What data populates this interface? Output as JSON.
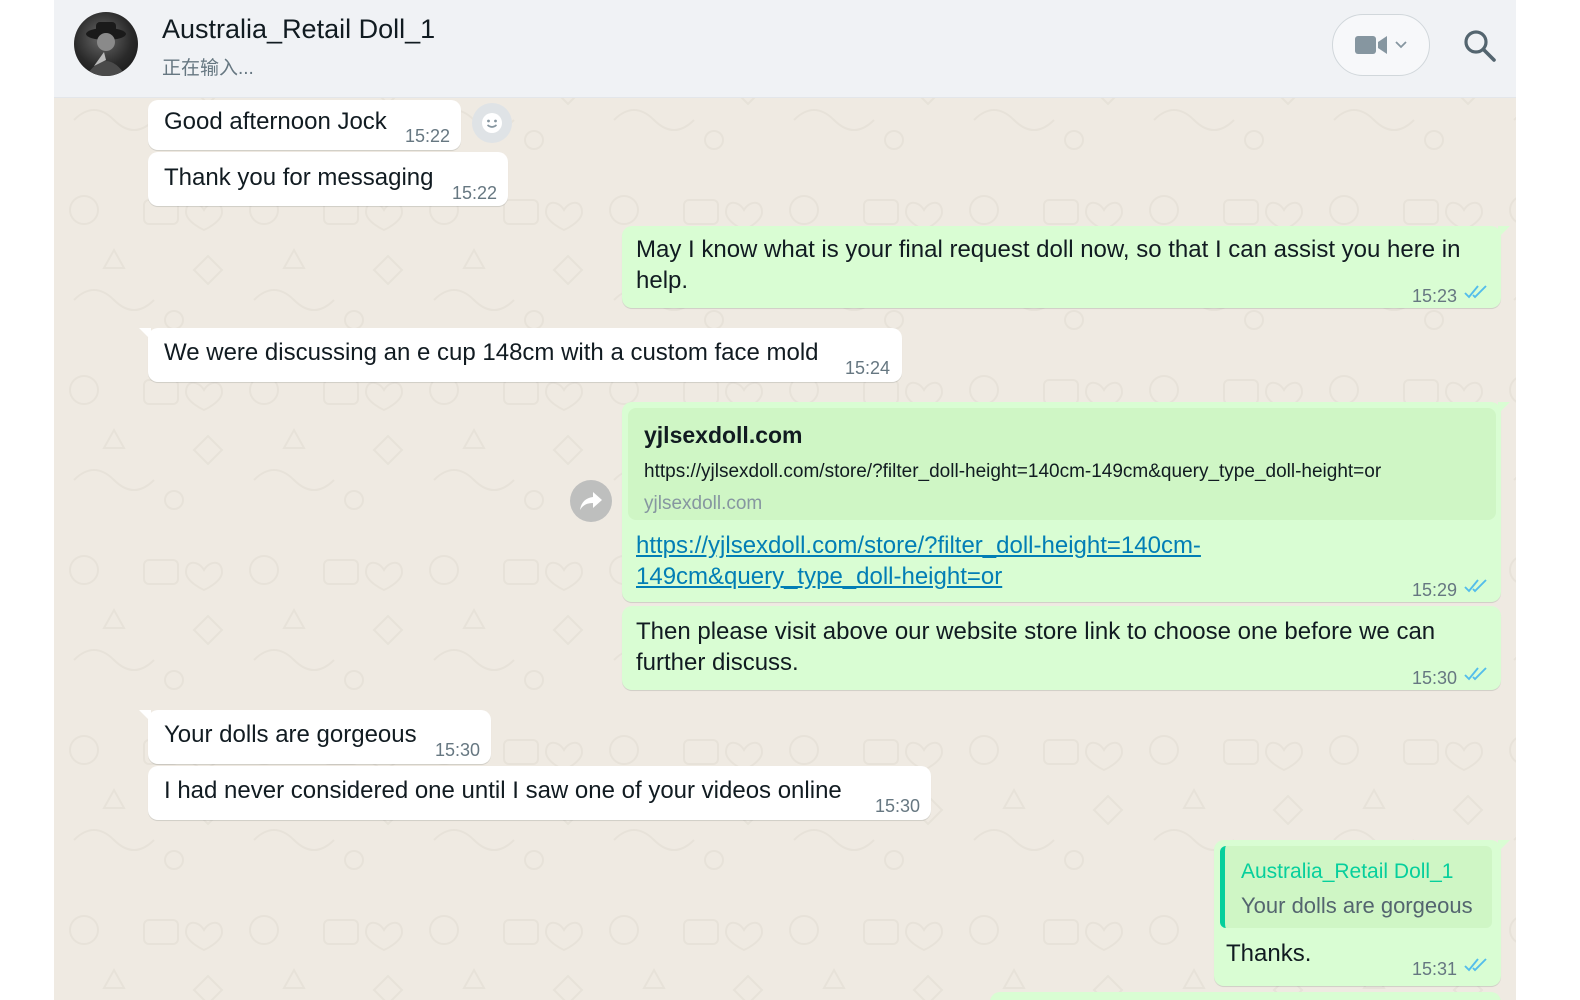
{
  "header": {
    "contact_name": "Australia_Retail Doll_1",
    "status": "正在输入...",
    "video_icon": "video-camera-icon",
    "dropdown_icon": "chevron-down-icon",
    "search_icon": "search-icon"
  },
  "colors": {
    "incoming_bubble": "#ffffff",
    "outgoing_bubble": "#d9fdd3",
    "chat_background": "#efeae2",
    "read_ticks": "#53bdeb",
    "link": "#027eb5",
    "quote_accent": "#06cf9c"
  },
  "messages": [
    {
      "id": "m1",
      "direction": "incoming",
      "text": "Good afternoon Jock",
      "time": "15:22"
    },
    {
      "id": "m2",
      "direction": "incoming",
      "text": "Thank you for messaging",
      "time": "15:22"
    },
    {
      "id": "m3",
      "direction": "outgoing",
      "lines": [
        "May I know what is your final request doll now, so that I can assist you here in",
        "help."
      ],
      "time": "15:23",
      "status": "read"
    },
    {
      "id": "m4",
      "direction": "incoming",
      "text": "We were discussing an e cup 148cm with a custom face mold",
      "time": "15:24"
    },
    {
      "id": "m5",
      "direction": "outgoing",
      "time": "15:29",
      "status": "read",
      "preview": {
        "title": "yjlsexdoll.com",
        "url": "https://yjlsexdoll.com/store/?filter_doll-height=140cm-149cm&query_type_doll-height=or",
        "domain": "yjlsexdoll.com"
      },
      "link_lines": [
        "https://yjlsexdoll.com/store/?filter_doll-height=140cm-",
        "149cm&query_type_doll-height=or"
      ]
    },
    {
      "id": "m6",
      "direction": "outgoing",
      "lines": [
        "Then please visit above our website store link to choose one before we can",
        "further discuss."
      ],
      "time": "15:30",
      "status": "read"
    },
    {
      "id": "m7",
      "direction": "incoming",
      "text": "Your dolls are gorgeous",
      "time": "15:30"
    },
    {
      "id": "m8",
      "direction": "incoming",
      "text": "I had never considered one until I saw one of your videos online",
      "time": "15:30"
    },
    {
      "id": "m9",
      "direction": "outgoing",
      "time": "15:31",
      "status": "read",
      "quote": {
        "author": "Australia_Retail Doll_1",
        "text": "Your dolls are gorgeous"
      },
      "text": "Thanks."
    }
  ]
}
